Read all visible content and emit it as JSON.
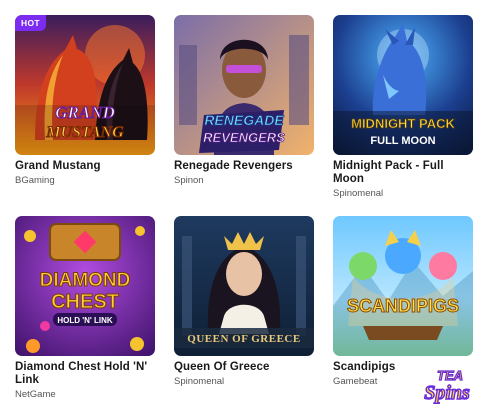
{
  "games": [
    {
      "title": "Grand Mustang",
      "provider": "BGaming",
      "badge": "HOT",
      "art_line1": "GRAND",
      "art_line2": "MUSTANG"
    },
    {
      "title": "Renegade Revengers",
      "provider": "Spinon",
      "art_line1": "RENEGADE",
      "art_line2": "REVENGERS"
    },
    {
      "title": "Midnight Pack - Full Moon",
      "provider": "Spinomenal",
      "art_line1": "MIDNIGHT PACK",
      "art_line2": "FULL MOON"
    },
    {
      "title": "Diamond Chest Hold 'N' Link",
      "provider": "NetGame",
      "art_line1": "DIAMOND",
      "art_line2": "CHEST",
      "art_line3": "HOLD 'N' LINK"
    },
    {
      "title": "Queen Of Greece",
      "provider": "Spinomenal",
      "art_line1": "QUEEN OF GREECE"
    },
    {
      "title": "Scandipigs",
      "provider": "Gamebeat",
      "art_line1": "SCANDIPIGS"
    }
  ],
  "brand": {
    "line1": "TEA",
    "line2": "Spins"
  },
  "colors": {
    "badge": "#7b2cf0",
    "brand_purple": "#6a2bd8"
  }
}
